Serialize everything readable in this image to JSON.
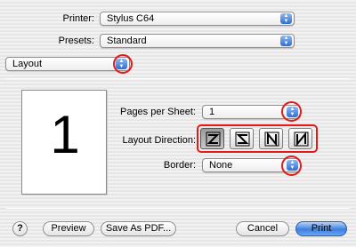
{
  "printer": {
    "label": "Printer:",
    "value": "Stylus C64"
  },
  "presets": {
    "label": "Presets:",
    "value": "Standard"
  },
  "panel_select": {
    "value": "Layout"
  },
  "preview": {
    "page_number": "1"
  },
  "pages_per_sheet": {
    "label": "Pages per Sheet:",
    "value": "1"
  },
  "layout_direction": {
    "label": "Layout Direction:",
    "options": [
      "left-to-right-then-down",
      "right-to-left-then-down",
      "top-to-bottom-then-right",
      "top-to-bottom-then-left"
    ],
    "selected_index": 0
  },
  "border": {
    "label": "Border:",
    "value": "None"
  },
  "buttons": {
    "help": "?",
    "preview": "Preview",
    "save_as_pdf": "Save As PDF...",
    "cancel": "Cancel",
    "print": "Print"
  },
  "colors": {
    "highlight": "#e21a1a",
    "accent": "#3b7fe0"
  }
}
